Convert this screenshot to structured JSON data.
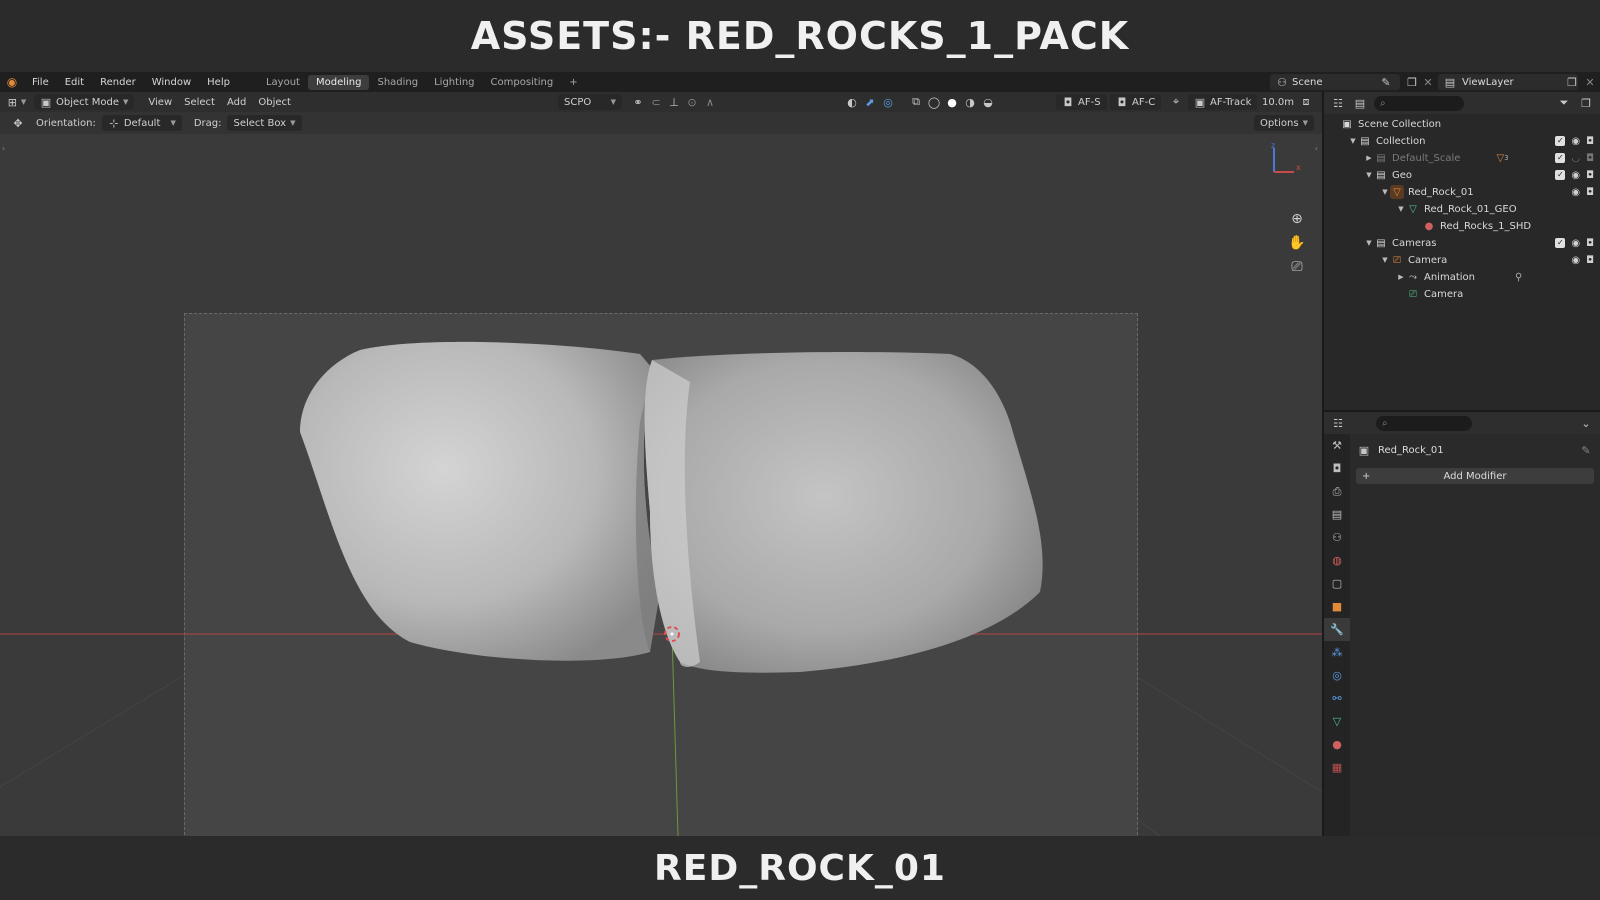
{
  "banner": {
    "title": "ASSETS:- RED_ROCKS_1_PACK",
    "caption": "RED_ROCK_01"
  },
  "menubar": {
    "items": [
      "File",
      "Edit",
      "Render",
      "Window",
      "Help"
    ],
    "workspaces": [
      "Layout",
      "Modeling",
      "Shading",
      "Lighting",
      "Compositing"
    ],
    "active_workspace": "Modeling",
    "add_workspace": "+",
    "scene": "Scene",
    "view_layer": "ViewLayer"
  },
  "viewport": {
    "mode": "Object Mode",
    "menus": [
      "View",
      "Select",
      "Add",
      "Object"
    ],
    "camera_preset": "SCPO",
    "af_s": "AF-S",
    "af_c": "AF-C",
    "af_track": "AF-Track",
    "distance": "10.0m",
    "orientation_label": "Orientation:",
    "orientation_value": "Default",
    "drag_label": "Drag:",
    "drag_value": "Select Box",
    "options": "Options",
    "gizmo_z": "z",
    "gizmo_x": "x"
  },
  "outliner": {
    "rows": [
      {
        "label": "Scene Collection"
      },
      {
        "label": "Collection"
      },
      {
        "label": "Default_Scale",
        "badge": "3"
      },
      {
        "label": "Geo"
      },
      {
        "label": "Red_Rock_01"
      },
      {
        "label": "Red_Rock_01_GEO"
      },
      {
        "label": "Red_Rocks_1_SHD"
      },
      {
        "label": "Cameras"
      },
      {
        "label": "Camera"
      },
      {
        "label": "Animation"
      },
      {
        "label": "Camera"
      }
    ]
  },
  "properties": {
    "object_name": "Red_Rock_01",
    "add_modifier": "Add Modifier"
  },
  "colors": {
    "accent": "#5c9ee6",
    "x_axis": "#b84444",
    "y_axis": "#6b9a3a",
    "orange": "#e08a3a",
    "green_icon": "#4fc08a"
  }
}
